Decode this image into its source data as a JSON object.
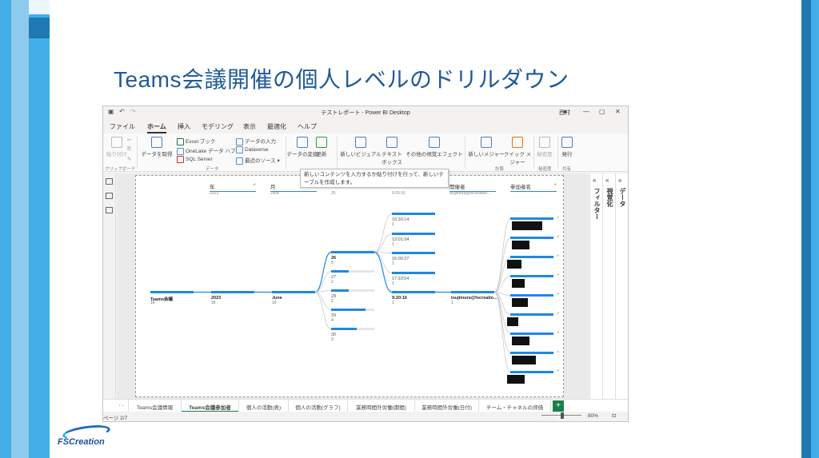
{
  "slide": {
    "title": "Teams会議開催の個人レベルのドリルダウン",
    "logo_text": "FSCreation"
  },
  "window": {
    "title": "テストレポート - Power BI Desktop",
    "user": "西村",
    "menu": [
      "ファイル",
      "ホーム",
      "挿入",
      "モデリング",
      "表示",
      "最適化",
      "ヘルプ"
    ],
    "active_menu": "ホーム"
  },
  "ribbon": {
    "paste": "貼り付け",
    "get_data": "データを取得",
    "excel": "Excel ブック",
    "onelake": "OneLake データ ハブ",
    "sql": "SQL Server",
    "enter_data": "データの入力",
    "dataverse": "Dataverse",
    "recent": "最近のソース",
    "transform": "データの変換",
    "refresh": "更新",
    "new_visual": "新しいビジュアル",
    "textbox": "テキスト ボックス",
    "more_visuals": "その他の視覚エフェクト",
    "new_measure": "新しいメジャー",
    "quick_measure": "クイック メジャー",
    "sensitivity": "秘密度",
    "publish": "発行",
    "groups": {
      "clipboard": "クリップボード",
      "data": "データ",
      "calc": "計算",
      "sensitivity": "秘密度",
      "share": "共有"
    }
  },
  "tooltip": "新しいコンテンツを入力するか貼り付けを行って、新しいテーブルを作成します。",
  "panes": {
    "filters": "フィルター",
    "visualizations": "視覚化",
    "data": "データ"
  },
  "tree": {
    "headers": [
      {
        "label": "年",
        "sub": "2023"
      },
      {
        "label": "月",
        "sub": "June"
      },
      {
        "label": "日",
        "sub": "26"
      },
      {
        "label": "時刻",
        "sub": "9:20:16"
      },
      {
        "label": "開催者",
        "sub": "tsujimura@fscreation..."
      },
      {
        "label": "参加者名",
        "sub": ""
      }
    ],
    "root": {
      "label": "Teams会議",
      "num": "16"
    },
    "year": {
      "label": "2023",
      "num": "16"
    },
    "month": {
      "label": "June",
      "num": "16"
    },
    "days": [
      {
        "label": "26",
        "num": "5"
      },
      {
        "label": "27",
        "num": "2"
      },
      {
        "label": "28",
        "num": "2"
      },
      {
        "label": "29",
        "num": "4"
      },
      {
        "label": "30",
        "num": "3"
      }
    ],
    "times": [
      {
        "label": "10:30:14",
        "num": "1"
      },
      {
        "label": "13:01:34",
        "num": "1"
      },
      {
        "label": "16:00:27",
        "num": "1"
      },
      {
        "label": "17:33:54",
        "num": "1"
      },
      {
        "label": "9:20:16",
        "num": "1"
      }
    ],
    "organizer": {
      "label": "tsujimura@fscreatio...",
      "num": "1"
    }
  },
  "tabs": [
    "Teams会議情報",
    "Teams会議参加者",
    "個人の活動(表)",
    "個人の活動(グラフ)",
    "業務時間外労働(期間)",
    "業務時間外労働(日付)",
    "チーム・チャネルの評価"
  ],
  "active_tab": "Teams会議参加者",
  "status": {
    "page": "ページ 2/7",
    "zoom": "80%"
  }
}
